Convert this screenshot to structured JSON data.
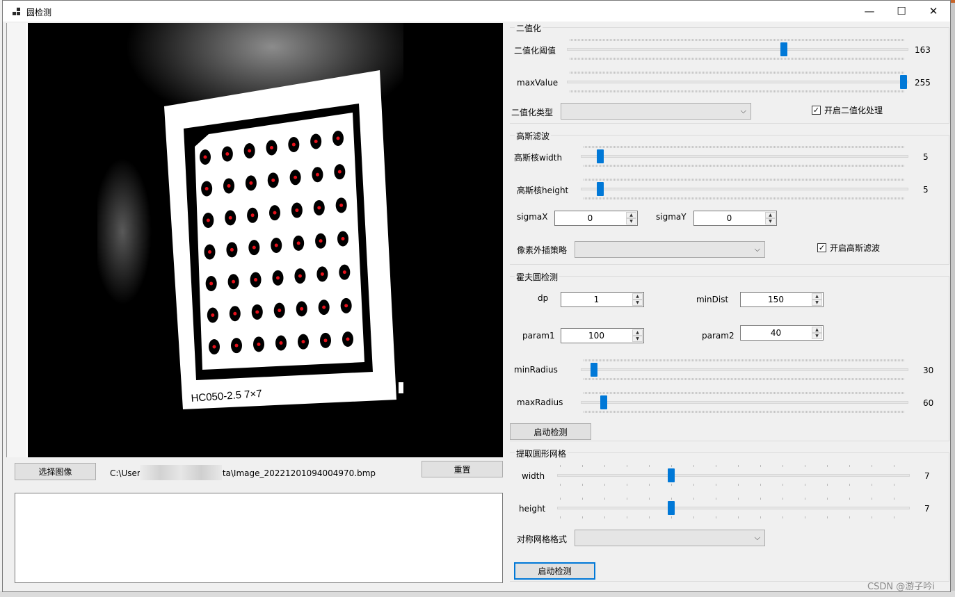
{
  "window": {
    "title": "圆检测",
    "minimize_glyph": "—",
    "maximize_glyph": "☐",
    "close_glyph": "✕"
  },
  "image_panel": {
    "board_label": "HC050-2.5  7×7",
    "select_button": "选择图像",
    "file_path_left": "C:\\User",
    "file_path_right": "ta\\Image_20221201094004970.bmp",
    "reset_button": "重置",
    "dot_rows": 7,
    "dot_cols": 7
  },
  "binarize": {
    "title": "二值化",
    "threshold_label": "二值化阈值",
    "threshold_value": "163",
    "threshold_fraction": 0.639,
    "max_label": "maxValue",
    "max_value": "255",
    "max_fraction": 1.0,
    "type_label": "二值化类型",
    "type_value": "",
    "enable_label": "开启二值化处理",
    "enabled": true
  },
  "gauss": {
    "title": "高斯滤波",
    "width_label": "高斯核width",
    "width_value": "5",
    "width_fraction": 0.05,
    "height_label": "高斯核height",
    "height_value": "5",
    "height_fraction": 0.05,
    "sigmax_label": "sigmaX",
    "sigmax_value": "0",
    "sigmay_label": "sigmaY",
    "sigmay_value": "0",
    "border_label": "像素外插策略",
    "border_value": "",
    "enable_label": "开启高斯滤波",
    "enabled": true
  },
  "hough": {
    "title": "霍夫圆检测",
    "dp_label": "dp",
    "dp_value": "1",
    "mindist_label": "minDist",
    "mindist_value": "150",
    "param1_label": "param1",
    "param1_value": "100",
    "param2_label": "param2",
    "param2_value": "40",
    "minradius_label": "minRadius",
    "minradius_value": "30",
    "minradius_fraction": 0.03,
    "maxradius_label": "maxRadius",
    "maxradius_value": "60",
    "maxradius_fraction": 0.06,
    "start_button": "启动检测"
  },
  "grid": {
    "title": "提取圆形网格",
    "width_label": "width",
    "width_value": "7",
    "width_fraction": 0.32,
    "height_label": "height",
    "height_value": "7",
    "height_fraction": 0.32,
    "format_label": "对称网格格式",
    "format_value": "",
    "start_button": "启动检测"
  },
  "watermark": "CSDN @游子吟i",
  "icons": {
    "check": "✓",
    "combo_arrow": "⌵",
    "spin_up": "▲",
    "spin_down": "▼"
  }
}
